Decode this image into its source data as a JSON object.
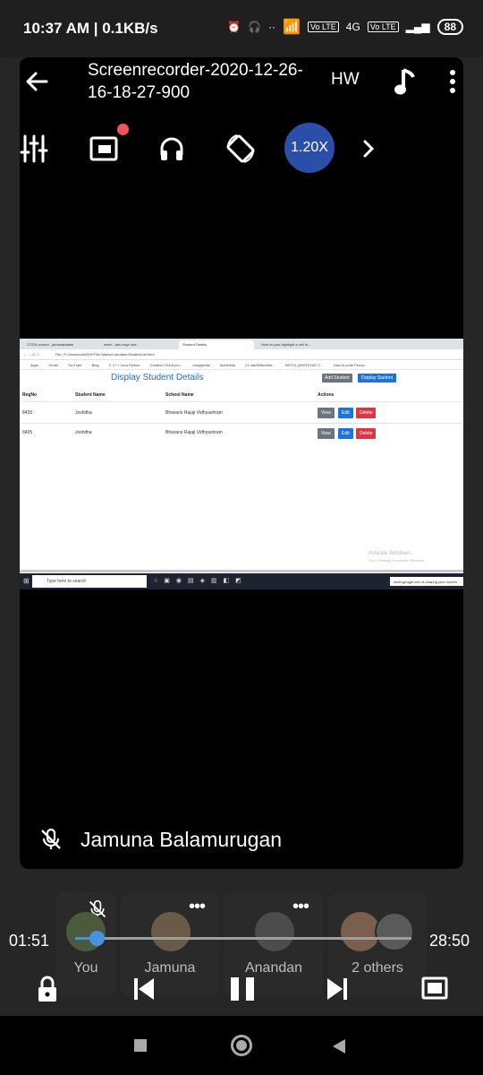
{
  "status_bar": {
    "time": "10:37 AM | 0.1KB/s",
    "net_tag_1": "Vo LTE",
    "net_4g": "4G",
    "net_tag_2": "Vo LTE",
    "battery": "88"
  },
  "player": {
    "title": "Screenrecorder-2020-12-26-16-18-27-900",
    "hw_label": "HW",
    "speed_label": "1.20X"
  },
  "recorded_screen": {
    "tabs": [
      "27229 unread - jamunabalam",
      "meet - abc-mcyr-zde",
      "Student Details",
      "How do you highlight a cell in..."
    ],
    "address": "File | F:/Jamuna/AWS/HTML/MarksCalculator/StudentList.html",
    "bookmarks": [
      "Apps",
      "Gmail",
      "YouTube",
      "Blog",
      "C C++ Java Python",
      "Creative Cloud pro...",
      "emojipedia",
      "AutoDesk",
      "21 dakSkilsurMA...",
      "HEXTA (WHITEHAT C...",
      "How to code Penup..."
    ],
    "page_title": "Display Student Details",
    "add_button": "Add Student",
    "display_button": "Display Student",
    "columns": [
      "RegNo",
      "Student Name",
      "School Name",
      "Actions"
    ],
    "rows": [
      {
        "regno": "8435",
        "name": "Joshitha",
        "school": "Bhavans Rajaji Vidhyashram"
      },
      {
        "regno": "8435",
        "name": "Joshitha",
        "school": "Bhavans Rajaji Vidhyashram"
      }
    ],
    "actions": {
      "view": "View",
      "edit": "Edit",
      "delete": "Delete"
    },
    "watermark_line1": "Activate Windows",
    "watermark_line2": "Go to Settings to activate Windows.",
    "taskbar_search": "Type here to search",
    "share_notice": "meet.google.com is sharing your screen"
  },
  "caption_name": "Jamuna Balamurugan",
  "participants": [
    {
      "label": "You"
    },
    {
      "label": "Jamuna"
    },
    {
      "label": "Anandan"
    },
    {
      "label": "2 others"
    }
  ],
  "playback": {
    "elapsed": "01:51",
    "duration": "28:50",
    "progress_fraction": 0.064
  },
  "colors": {
    "speed_bg": "#2b4fa8",
    "seek_accent": "#4a90e2",
    "record_dot": "#f2545b"
  }
}
